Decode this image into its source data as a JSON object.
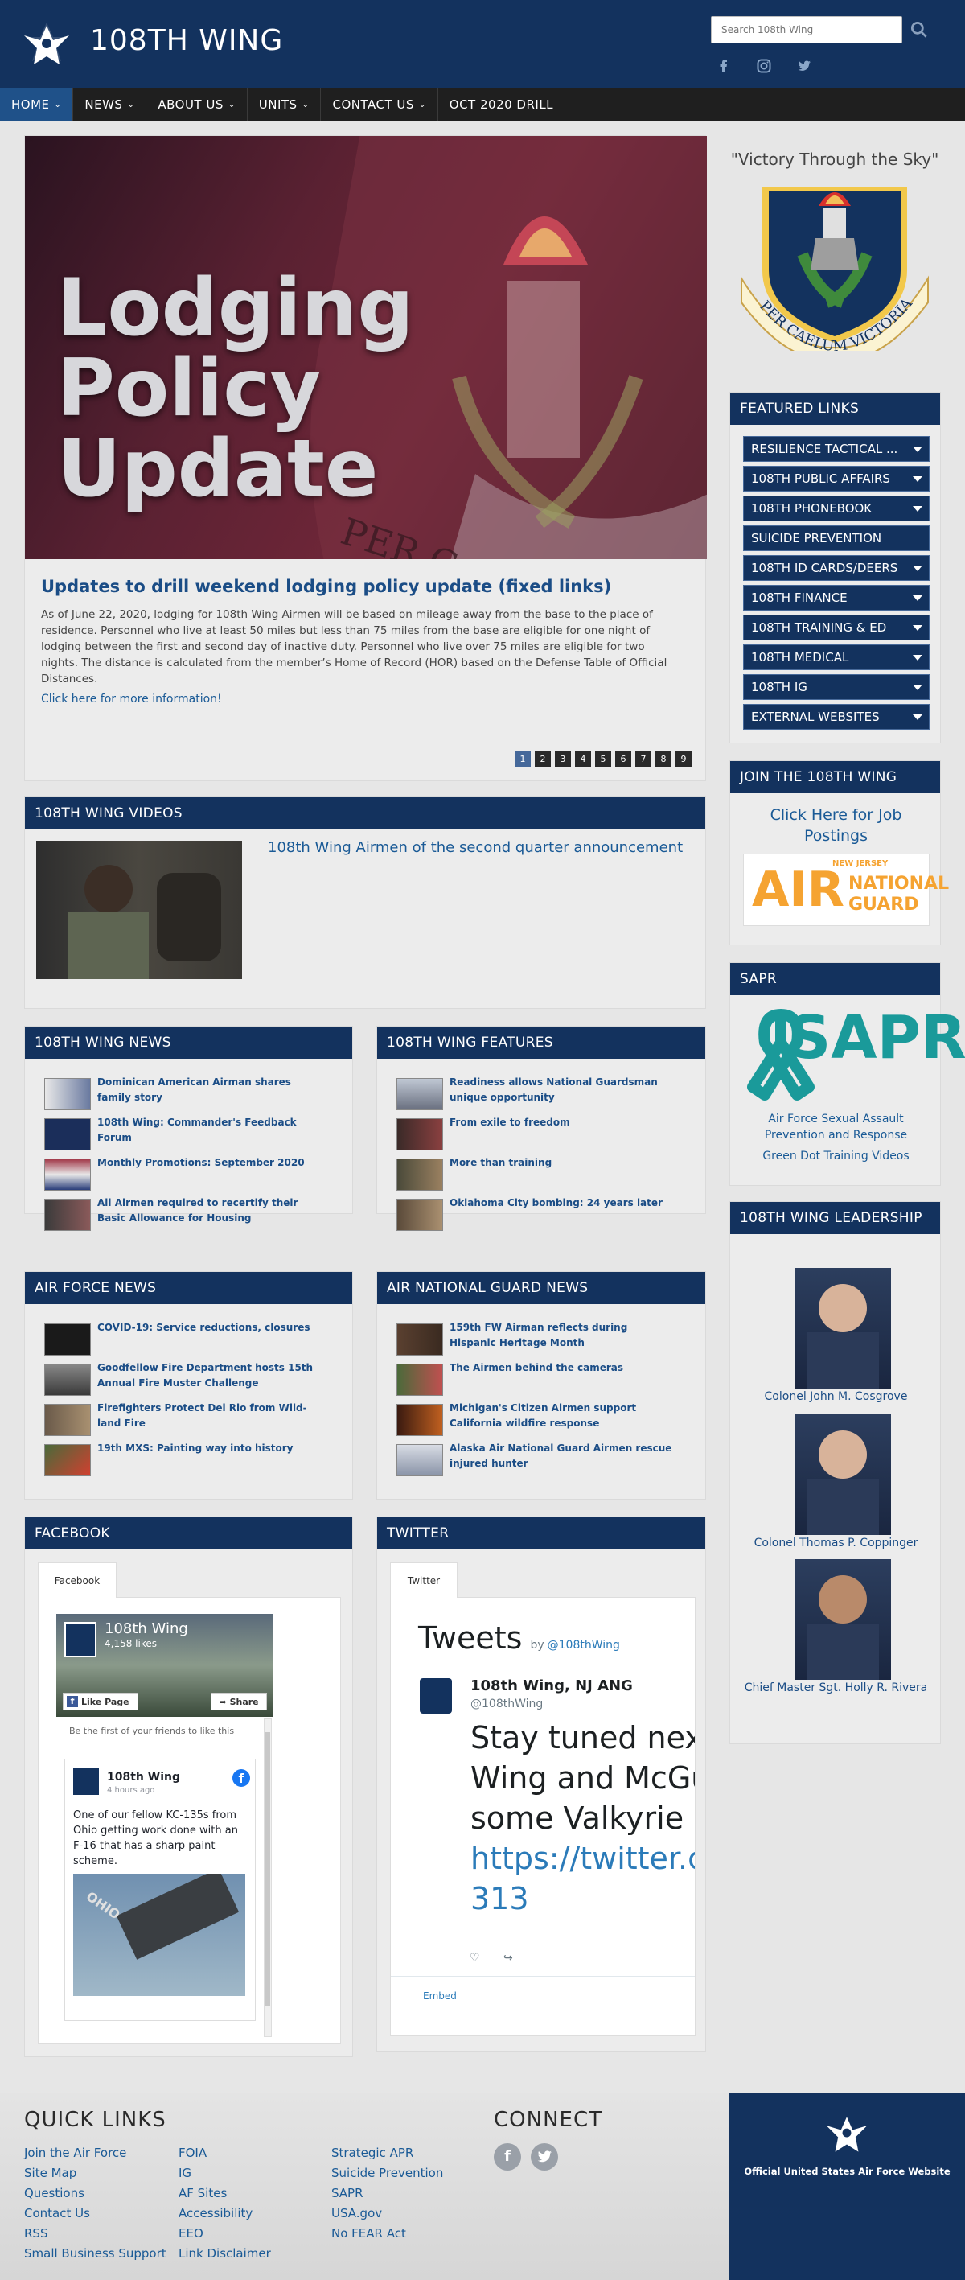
{
  "header": {
    "title": "108TH WING",
    "search_placeholder": "Search 108th Wing",
    "social": [
      "facebook-icon",
      "instagram-icon",
      "twitter-icon"
    ]
  },
  "nav": [
    {
      "label": "HOME",
      "dropdown": true,
      "active": true
    },
    {
      "label": "NEWS",
      "dropdown": true
    },
    {
      "label": "ABOUT US",
      "dropdown": true
    },
    {
      "label": "UNITS",
      "dropdown": true
    },
    {
      "label": "CONTACT US",
      "dropdown": true
    },
    {
      "label": "OCT 2020 DRILL",
      "dropdown": false
    }
  ],
  "hero": {
    "image_line1": "Lodging",
    "image_line2": "Policy",
    "image_line3": "Update",
    "title": "Updates to drill weekend lodging policy update (fixed links)",
    "body": "As of June 22, 2020, lodging for 108th Wing Airmen will be based on mileage away from the base to the place of residence. Personnel who live at least 50 miles but less than 75 miles from the base are eligible for one night of lodging between the first and second day of inactive duty. Personnel who live over 75 miles are eligible for two nights. The distance is calculated from the member’s Home of Record (HOR) based on the Defense Table of Official Distances.",
    "link": "Click here for more information!",
    "pages": [
      "1",
      "2",
      "3",
      "4",
      "5",
      "6",
      "7",
      "8",
      "9"
    ]
  },
  "sidebar": {
    "motto": "\"Victory Through the Sky\"",
    "crest_scroll": "PER CAELUM VICTORIAE",
    "featured_title": "FEATURED LINKS",
    "featured_links": [
      {
        "label": "RESILIENCE TACTICAL ...",
        "dropdown": true
      },
      {
        "label": "108TH PUBLIC AFFAIRS",
        "dropdown": true
      },
      {
        "label": "108TH PHONEBOOK",
        "dropdown": true
      },
      {
        "label": "SUICIDE PREVENTION",
        "dropdown": false
      },
      {
        "label": "108TH ID CARDS/DEERS",
        "dropdown": true
      },
      {
        "label": "108TH FINANCE",
        "dropdown": true
      },
      {
        "label": "108TH TRAINING & ED",
        "dropdown": true
      },
      {
        "label": "108TH MEDICAL",
        "dropdown": true
      },
      {
        "label": "108TH IG",
        "dropdown": true
      },
      {
        "label": "EXTERNAL WEBSITES",
        "dropdown": true
      }
    ],
    "join_title": "JOIN THE 108TH WING",
    "join_link": "Click Here for Job Postings",
    "ang_top": "NEW JERSEY",
    "ang_air": "AIR",
    "ang_national": "NATIONAL",
    "ang_guard": "GUARD",
    "sapr_title": "SAPR",
    "sapr_logo": "SAPR",
    "sapr_text": "Air Force Sexual Assault Prevention and Response",
    "sapr_link": "Green Dot Training Videos",
    "leadership_title": "108TH WING LEADERSHIP",
    "leaders": [
      "Colonel John M. Cosgrove",
      "Colonel Thomas P. Coppinger",
      "Chief Master Sgt. Holly R. Rivera"
    ]
  },
  "videos": {
    "title": "108TH WING VIDEOS",
    "video_title": "108th Wing Airmen of the second quarter announcement"
  },
  "wing_news": {
    "title": "108TH WING NEWS",
    "items": [
      "Dominican American Airman shares family story",
      "108th Wing: Commander's Feedback Forum",
      "Monthly Promotions: September 2020",
      "All Airmen required to recertify their Basic Allowance for Housing"
    ]
  },
  "wing_features": {
    "title": "108TH WING FEATURES",
    "items": [
      "Readiness allows National Guardsman unique opportunity",
      "From exile to freedom",
      "More than training",
      "Oklahoma City bombing: 24 years later"
    ]
  },
  "af_news": {
    "title": "AIR FORCE NEWS",
    "items": [
      "COVID-19: Service reductions, closures",
      "Goodfellow Fire Department hosts 15th Annual Fire Muster Challenge",
      "Firefighters Protect Del Rio from Wild-land Fire",
      "19th MXS: Painting way into history"
    ]
  },
  "ang_news": {
    "title": "AIR NATIONAL GUARD NEWS",
    "items": [
      "159th FW Airman reflects during Hispanic Heritage Month",
      "The Airmen behind the cameras",
      "Michigan's Citizen Airmen support California wildfire response",
      "Alaska Air National Guard Airmen rescue injured hunter"
    ]
  },
  "facebook": {
    "title": "FACEBOOK",
    "tab": "Facebook",
    "page_name": "108th Wing",
    "likes": "4,158 likes",
    "like_btn": "Like Page",
    "share_btn": "Share",
    "friends": "Be the first of your friends to like this",
    "post_author": "108th Wing",
    "post_time": "4 hours ago",
    "post_text": "One of our fellow KC-135s from Ohio getting work done with an F-16 that has a sharp paint scheme.",
    "tanker_label": "OHIO"
  },
  "twitter": {
    "title": "TWITTER",
    "tab": "Twitter",
    "heading": "Tweets",
    "by": "by",
    "handle": "@108thWing",
    "account_name": "108th Wing, NJ ANG",
    "account_handle": "@108thWing",
    "tweet_line1": "Stay tuned nex",
    "tweet_line2": "Wing and McGu",
    "tweet_line3": "some Valkyrie l",
    "tweet_link1": "https://twitter.c",
    "tweet_link2": "313",
    "embed": "Embed"
  },
  "footer": {
    "quick_links_title": "QUICK LINKS",
    "col1": [
      "Join the Air Force",
      "Site Map",
      "Questions",
      "Contact Us",
      "RSS",
      "Small Business Support"
    ],
    "col2": [
      "FOIA",
      "IG",
      "AF Sites",
      "Accessibility",
      "EEO",
      "Link Disclaimer"
    ],
    "col3": [
      "Strategic APR",
      "Suicide Prevention",
      "SAPR",
      "USA.gov",
      "No FEAR Act"
    ],
    "connect_title": "CONNECT",
    "official": "Official United States Air Force Website"
  },
  "colors": {
    "navy": "#13325e",
    "link": "#1a5a96",
    "active_nav": "#1f5189",
    "ang_orange": "#f5a331",
    "sapr_teal": "#1a9a9a"
  }
}
